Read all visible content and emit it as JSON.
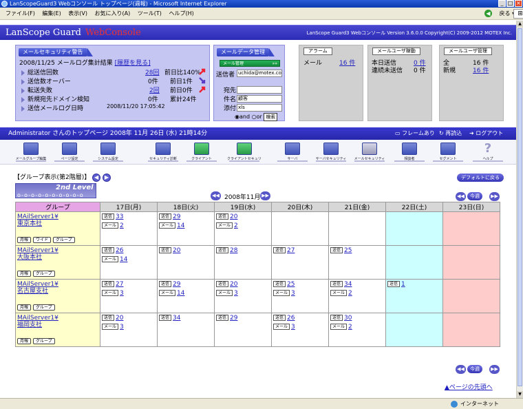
{
  "window": {
    "title": "LanScopeGuard3 Webコンソール トップページ(週報) - Microsoft Internet Explorer"
  },
  "menu": {
    "items": [
      "ファイル(F)",
      "編集(E)",
      "表示(V)",
      "お気に入り(A)",
      "ツール(T)",
      "ヘルプ(H)"
    ],
    "back_label": "戻る"
  },
  "header": {
    "logo_main": "LanScope Guard",
    "logo_sub": "WebConsole",
    "version": "LanScope Guard3 Webコンソール Version 3.6.0.0  Copyright(C) 2009-2012 MOTEX Inc."
  },
  "mail_alert": {
    "tab": "メールセキュリティ警告",
    "summary": "2008/11/25 メールログ集計結果",
    "history_link": "[履歴を見る]",
    "rows": [
      {
        "label": "総送信回数",
        "value": "28回",
        "compare": "前日比140%"
      },
      {
        "label": "送信数オーバー",
        "value": "0件",
        "compare": "前日1件"
      },
      {
        "label": "転送失敗",
        "value": "2回",
        "compare": "前日0件"
      },
      {
        "label": "新規宛先ドメイン検知",
        "value": "0件",
        "compare": "累計24件"
      },
      {
        "label": "送信メールログ日時",
        "value": "2008/11/20 17:05:42",
        "compare": ""
      }
    ]
  },
  "mail_data": {
    "tab": "メールデータ管理",
    "btn": "メール管理",
    "sender_label": "送信者",
    "sender_value": "uchida@motex.co.jp",
    "to_label": "宛先",
    "subject_label": "件名",
    "subject_value": "顧客",
    "attach_label": "添付",
    "attach_value": "xls",
    "and_label": "and",
    "or_label": "or",
    "search_btn": "検索"
  },
  "alarm": {
    "tab": "アラーム",
    "label": "メール",
    "value": "16 件"
  },
  "mail_user_active": {
    "tab": "メールユーザ稼動",
    "rows": [
      {
        "label": "本日送信",
        "value": "0 件"
      },
      {
        "label": "連続未送信",
        "value": "0 件"
      }
    ]
  },
  "mail_user_mgmt": {
    "tab": "メールユーザ管理",
    "rows": [
      {
        "label": "全",
        "value": "16 件"
      },
      {
        "label": "新規",
        "value": "16 件"
      }
    ]
  },
  "nav": {
    "user": "Administrator  さんのトップページ  2008年 11月 26日 (水) 21時14分",
    "frame": "フレームあり",
    "reload": "再読込",
    "logout": "ログアウト"
  },
  "tools": [
    "メールグループ編集",
    "ページ設定",
    "システム設定",
    "セキュリティ診断",
    "クライアント",
    "クライアントセキュリティ",
    "サーバ",
    "サーバセキュリティ",
    "メールセキュリティ",
    "相談者",
    "セグメント",
    "ヘルプ"
  ],
  "group_view": {
    "title": "【グループ表示(第2階層)】",
    "level": "2nd Level",
    "default_btn": "デフォルトに戻る",
    "month": "2008年11月",
    "this_week": "今週"
  },
  "calendar": {
    "group_header": "グループ",
    "days": [
      "17日(月)",
      "18日(火)",
      "19日(水)",
      "20日(木)",
      "21日(金)",
      "22日(土)",
      "23日(日)"
    ],
    "tag_send": "送信",
    "tag_mail": "メール",
    "btn_month": "月報",
    "btn_wide": "ワイド",
    "btn_group": "グループ",
    "groups": [
      {
        "server": "MAilServer1¥",
        "name": "東京本社",
        "wide": true,
        "cells": [
          [
            "33",
            "2"
          ],
          [
            "29",
            "14"
          ],
          [
            "20",
            "2"
          ],
          [
            "",
            ""
          ],
          [
            "",
            ""
          ],
          [
            "",
            ""
          ],
          [
            "",
            ""
          ]
        ]
      },
      {
        "server": "MAilServer1¥",
        "name": "大阪本社",
        "wide": false,
        "cells": [
          [
            "26",
            "14"
          ],
          [
            "20",
            ""
          ],
          [
            "28",
            ""
          ],
          [
            "27",
            ""
          ],
          [
            "25",
            ""
          ],
          [
            "",
            ""
          ],
          [
            "",
            ""
          ]
        ]
      },
      {
        "server": "MAilServer1¥",
        "name": "名古屋支社",
        "wide": false,
        "cells": [
          [
            "27",
            "3"
          ],
          [
            "29",
            "14"
          ],
          [
            "20",
            "3"
          ],
          [
            "25",
            "3"
          ],
          [
            "34",
            "2"
          ],
          [
            "1",
            ""
          ],
          [
            "",
            ""
          ]
        ]
      },
      {
        "server": "MAilServer1¥",
        "name": "福岡支社",
        "wide": false,
        "cells": [
          [
            "20",
            "3"
          ],
          [
            "34",
            ""
          ],
          [
            "29",
            ""
          ],
          [
            "26",
            "3"
          ],
          [
            "30",
            "2"
          ],
          [
            "",
            ""
          ],
          [
            "",
            ""
          ]
        ]
      }
    ]
  },
  "page_top": "▲ページの先頭へ",
  "status": {
    "zone": "インターネット"
  },
  "colors": {
    "header": "#2b2bb5",
    "panel": "#c6c6f2",
    "saturday": "#ccffff",
    "sunday": "#ffcccc",
    "group": "#ffffcc"
  }
}
